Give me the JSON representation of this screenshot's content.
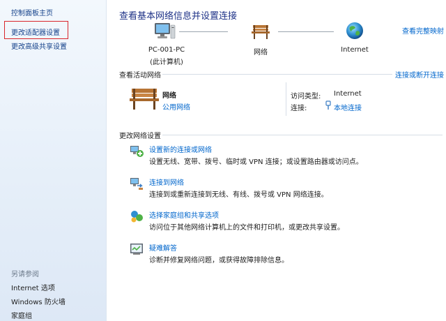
{
  "sidebar": {
    "home": "控制面板主页",
    "adapter": "更改适配器设置",
    "advanced": "更改高级共享设置",
    "see_also": "另请参阅",
    "internet_options": "Internet 选项",
    "firewall": "Windows 防火墙",
    "homegroup": "家庭组"
  },
  "header": {
    "title": "查看基本网络信息并设置连接",
    "full_map": "查看完整映射"
  },
  "map": {
    "pc_name": "PC-001-PC",
    "pc_sub": "(此计算机)",
    "network": "网络",
    "internet": "Internet"
  },
  "active": {
    "heading": "查看活动网络",
    "connect_link": "连接或断开连接",
    "name": "网络",
    "type": "公用网络",
    "access_label": "访问类型:",
    "access_value": "Internet",
    "conn_label": "连接:",
    "conn_value": "本地连接"
  },
  "settings": {
    "heading": "更改网络设置",
    "tasks": [
      {
        "title": "设置新的连接或网络",
        "desc": "设置无线、宽带、拨号、临时或 VPN 连接；或设置路由器或访问点。"
      },
      {
        "title": "连接到网络",
        "desc": "连接到或重新连接到无线、有线、拨号或 VPN 网络连接。"
      },
      {
        "title": "选择家庭组和共享选项",
        "desc": "访问位于其他网络计算机上的文件和打印机，或更改共享设置。"
      },
      {
        "title": "疑难解答",
        "desc": "诊断并修复网络问题，或获得故障排除信息。"
      }
    ]
  },
  "colors": {
    "link": "#0066cc",
    "title": "#1e3287",
    "sidebar_link": "#15428b",
    "highlight": "#d9252b"
  }
}
